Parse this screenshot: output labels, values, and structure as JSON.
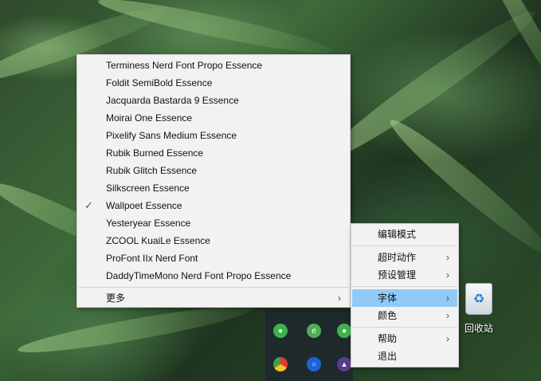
{
  "font_menu": {
    "items": [
      "Terminess Nerd Font Propo Essence",
      "Foldit SemiBold Essence",
      "Jacquarda Bastarda 9 Essence",
      "Moirai One Essence",
      "Pixelify Sans Medium Essence",
      "Rubik Burned Essence",
      "Rubik Glitch Essence",
      "Silkscreen Essence",
      "Wallpoet Essence",
      "Yesteryear Essence",
      "ZCOOL KuaiLe Essence",
      "ProFont IIx Nerd Font",
      "DaddyTimeMono Nerd Font Propo Essence"
    ],
    "checked_item": "Wallpoet Essence",
    "more_label": "更多",
    "check_glyph": "✓",
    "arrow_glyph": "›"
  },
  "main_menu": {
    "edit_mode": "编辑模式",
    "timeout_action": "超时动作",
    "preset_manage": "预设管理",
    "font": "字体",
    "color": "颜色",
    "help": "帮助",
    "exit": "退出",
    "arrow_glyph": "›"
  },
  "desktop": {
    "recycle_bin_label": "回收站"
  },
  "colors": {
    "menu_bg": "#f2f2f2",
    "highlight": "#91c9f7",
    "check": "#2c5a8a"
  },
  "icons": {
    "recycle_bin": "recycle-bin-icon",
    "tray": [
      "wechat-icon",
      "edge-icon",
      "wechat-icon",
      "chrome-icon",
      "circle-app-icon",
      "game-icon"
    ]
  }
}
